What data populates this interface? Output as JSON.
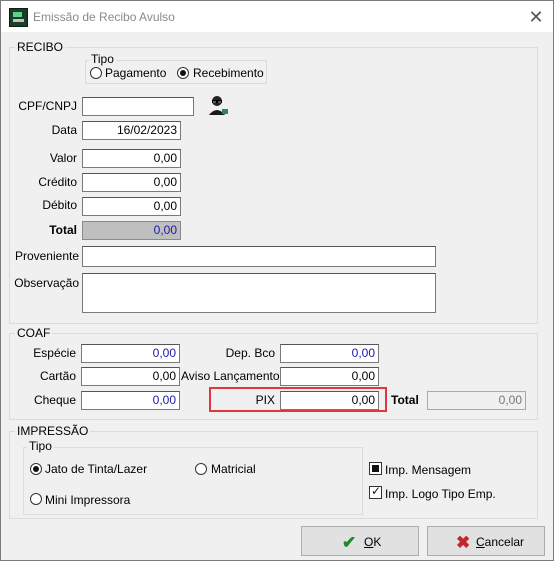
{
  "window": {
    "title": "Emissão de Recibo Avulso",
    "close_glyph": "✕"
  },
  "recibo": {
    "legend": "RECIBO",
    "tipo": {
      "legend": "Tipo",
      "options": [
        "Pagamento",
        "Recebimento"
      ],
      "selected": "Recebimento"
    },
    "cpf_label": "CPF/CNPJ",
    "cpf_value": "",
    "data_label": "Data",
    "data_value": "16/02/2023",
    "valor_label": "Valor",
    "valor_value": "0,00",
    "credito_label": "Crédito",
    "credito_value": "0,00",
    "debito_label": "Débito",
    "debito_value": "0,00",
    "total_label": "Total",
    "total_value": "0,00",
    "proveniente_label": "Proveniente",
    "proveniente_value": "",
    "observacao_label": "Observação",
    "observacao_value": ""
  },
  "coaf": {
    "legend": "COAF",
    "especie_label": "Espécie",
    "especie_value": "0,00",
    "cartao_label": "Cartão",
    "cartao_value": "0,00",
    "cheque_label": "Cheque",
    "cheque_value": "0,00",
    "dep_bco_label": "Dep. Bco",
    "dep_bco_value": "0,00",
    "aviso_label": "Aviso Lançamento",
    "aviso_value": "0,00",
    "pix_label": "PIX",
    "pix_value": "0,00",
    "total_label": "Total",
    "total_value": "0,00"
  },
  "impressao": {
    "legend": "IMPRESSÃO",
    "tipo_legend": "Tipo",
    "options": [
      "Jato de Tinta/Lazer",
      "Matricial",
      "Mini Impressora"
    ],
    "selected": "Jato de Tinta/Lazer",
    "imp_mensagem": "Imp. Mensagem",
    "imp_logo": "Imp. Logo Tipo Emp."
  },
  "buttons": {
    "ok_prefix": "",
    "ok_underline": "O",
    "ok_rest": "K",
    "cancel_underline": "C",
    "cancel_rest": "ancelar"
  },
  "colors": {
    "highlight": "#e0373c",
    "value_text": "#1a1aa6"
  }
}
